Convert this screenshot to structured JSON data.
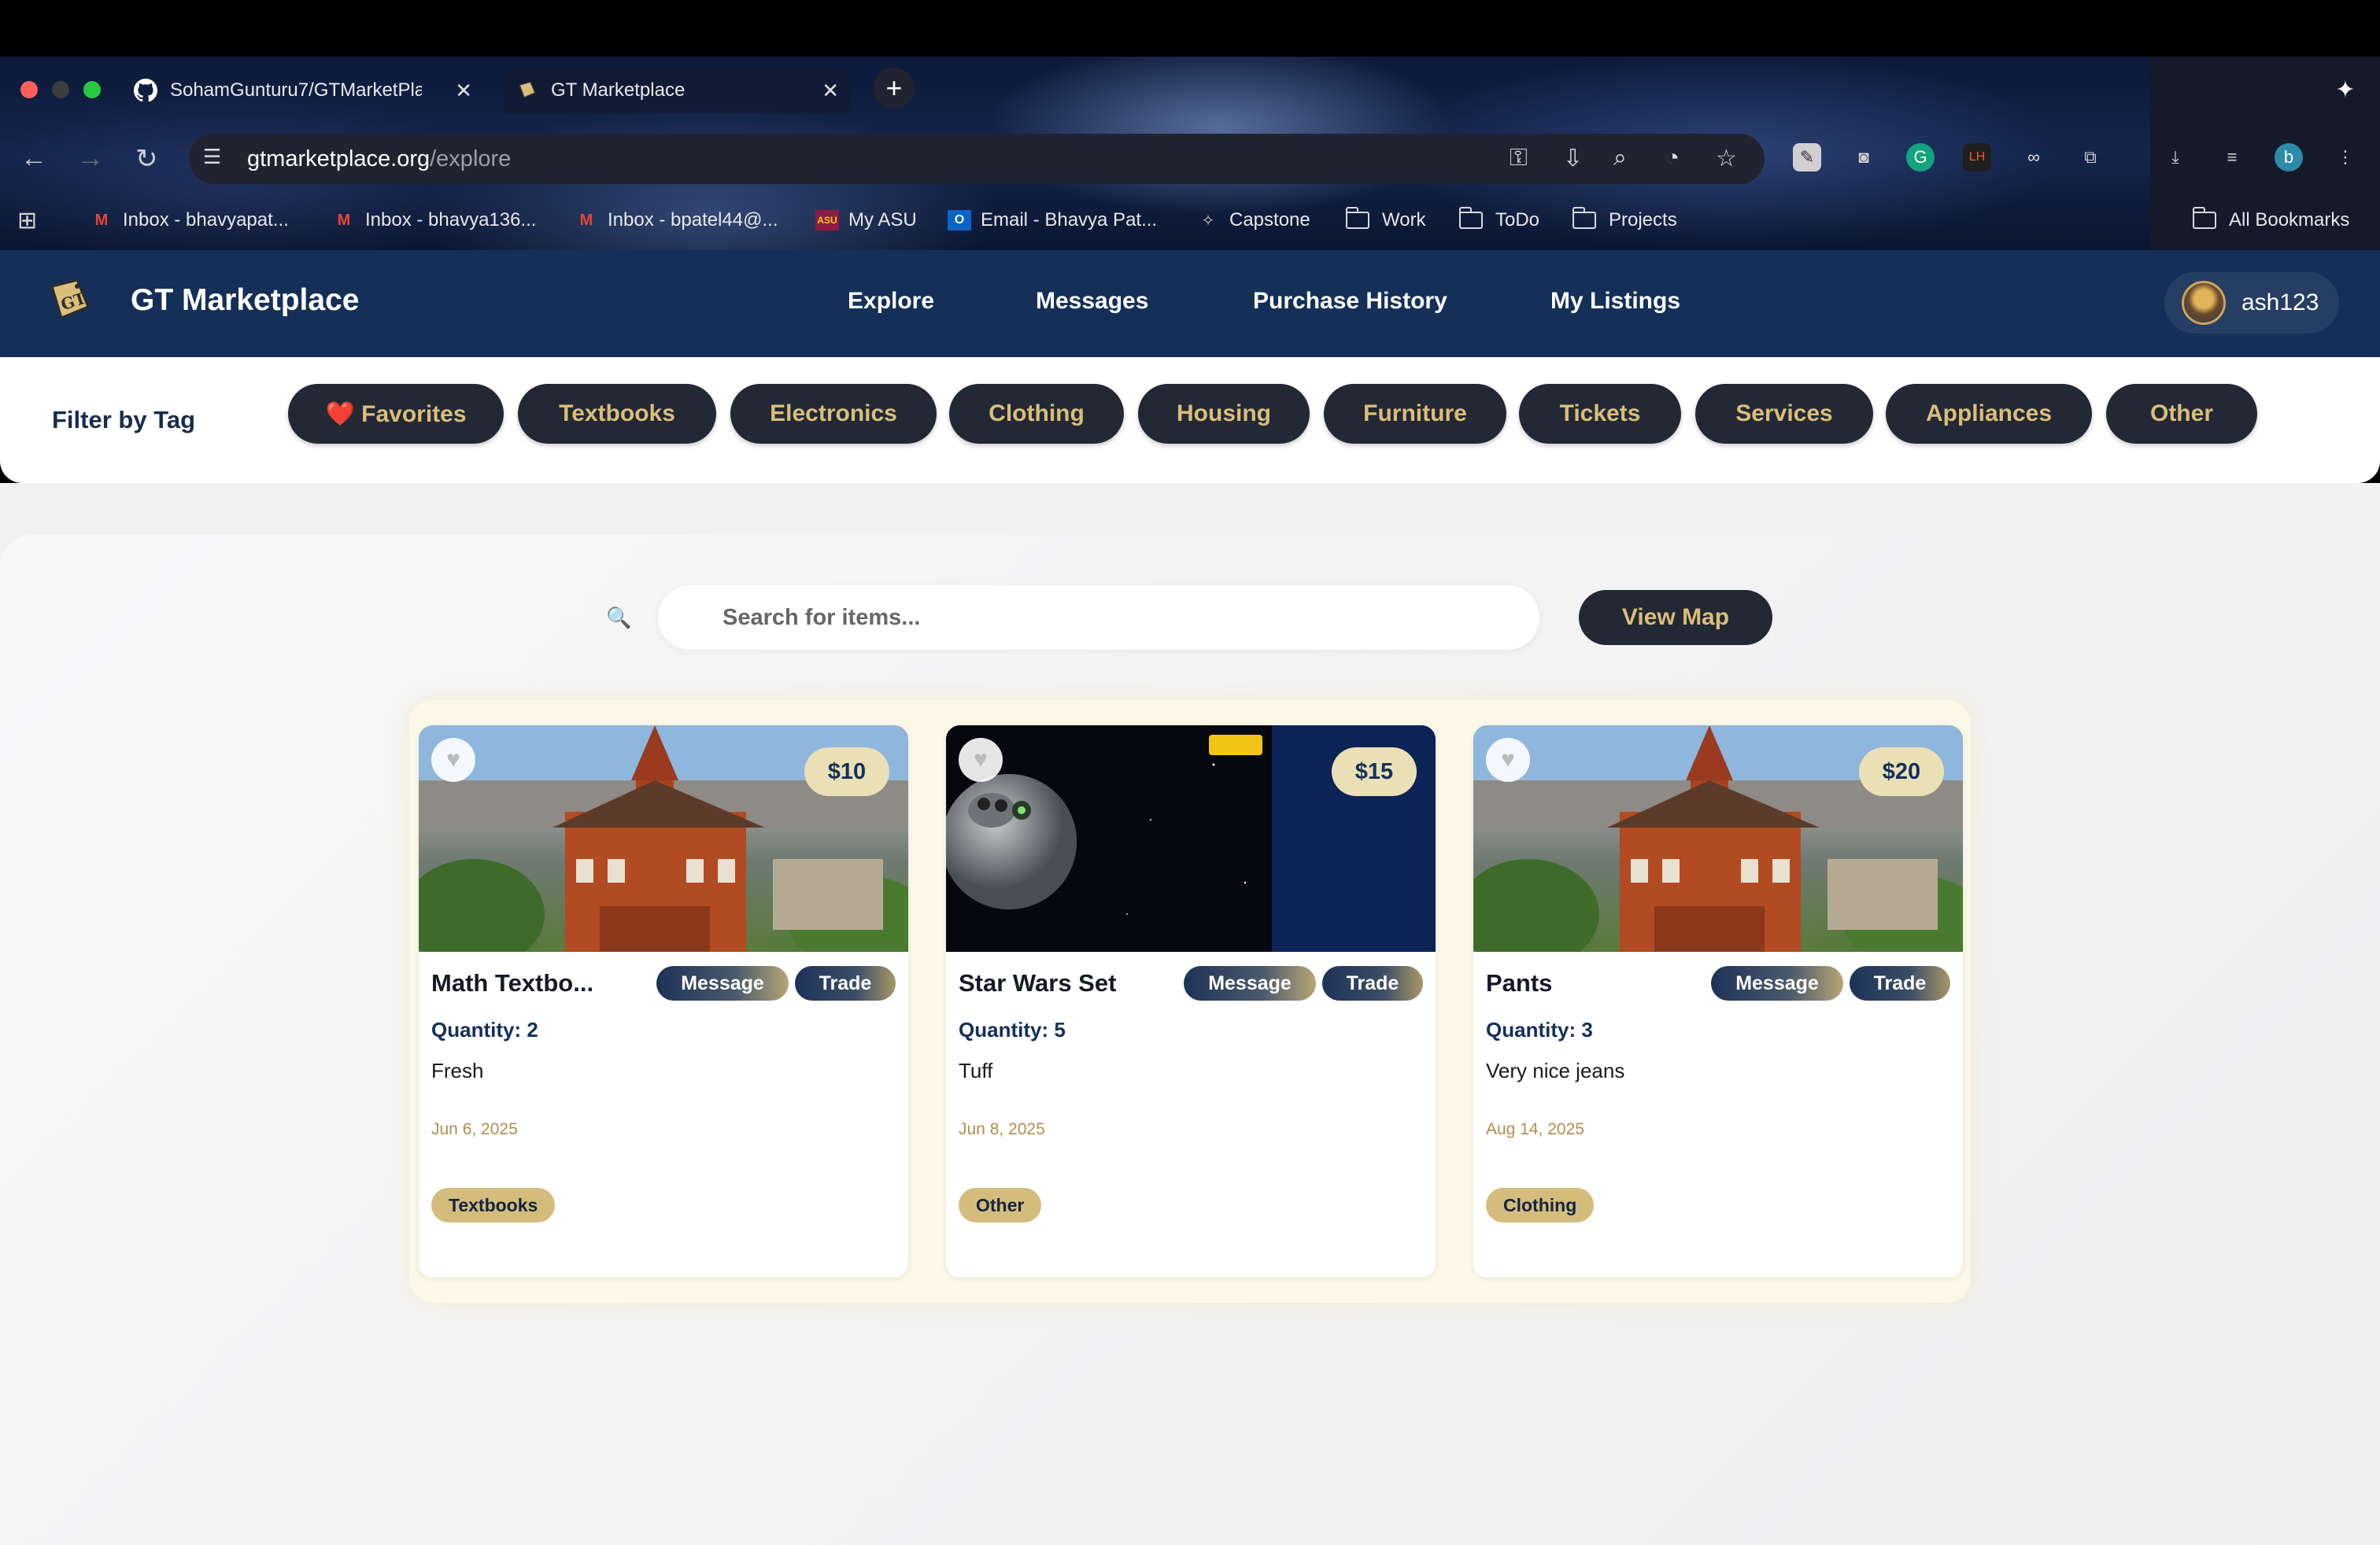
{
  "browser": {
    "tabs": [
      {
        "label": "SohamGunturu7/GTMarketPla",
        "icon": "github-icon"
      },
      {
        "label": "GT Marketplace",
        "icon": "gt-logo-icon"
      }
    ],
    "url_host": "gtmarketplace.org",
    "url_path": "/explore",
    "bookmarks": [
      {
        "label": "Inbox - bhavyapat...",
        "icon": "gmail-icon"
      },
      {
        "label": "Inbox - bhavya136...",
        "icon": "gmail-icon"
      },
      {
        "label": "Inbox - bpatel44@...",
        "icon": "gmail-icon"
      },
      {
        "label": "My ASU",
        "icon": "asu-icon"
      },
      {
        "label": "Email - Bhavya Pat...",
        "icon": "outlook-icon"
      },
      {
        "label": "Capstone",
        "icon": "sparkle-icon"
      },
      {
        "label": "Work",
        "icon": "folder-icon"
      },
      {
        "label": "ToDo",
        "icon": "folder-icon"
      },
      {
        "label": "Projects",
        "icon": "folder-icon"
      }
    ],
    "all_bookmarks": "All Bookmarks",
    "profile_initial": "b"
  },
  "app": {
    "brand": "GT Marketplace",
    "nav": [
      "Explore",
      "Messages",
      "Purchase History",
      "My Listings"
    ],
    "username": "ash123"
  },
  "filter": {
    "label": "Filter by Tag",
    "tags": [
      "❤️ Favorites",
      "Textbooks",
      "Electronics",
      "Clothing",
      "Housing",
      "Furniture",
      "Tickets",
      "Services",
      "Appliances",
      "Other"
    ]
  },
  "search": {
    "placeholder": "Search for items...",
    "map_button": "View Map"
  },
  "listings": [
    {
      "title": "Math Textbo...",
      "price": "$10",
      "quantity": "Quantity: 2",
      "description": "Fresh",
      "date": "Jun 6, 2025",
      "category": "Textbooks",
      "image": "tech-tower"
    },
    {
      "title": "Star Wars Set",
      "price": "$15",
      "quantity": "Quantity: 5",
      "description": "Tuff",
      "date": "Jun 8, 2025",
      "category": "Other",
      "image": "star-wars-jenga"
    },
    {
      "title": "Pants",
      "price": "$20",
      "quantity": "Quantity: 3",
      "description": "Very nice jeans",
      "date": "Aug 14, 2025",
      "category": "Clothing",
      "image": "tech-tower"
    }
  ],
  "card_actions": {
    "message": "Message",
    "trade": "Trade"
  },
  "colors": {
    "navy": "#143058",
    "gold": "#d9be7a",
    "pill": "#222834"
  }
}
